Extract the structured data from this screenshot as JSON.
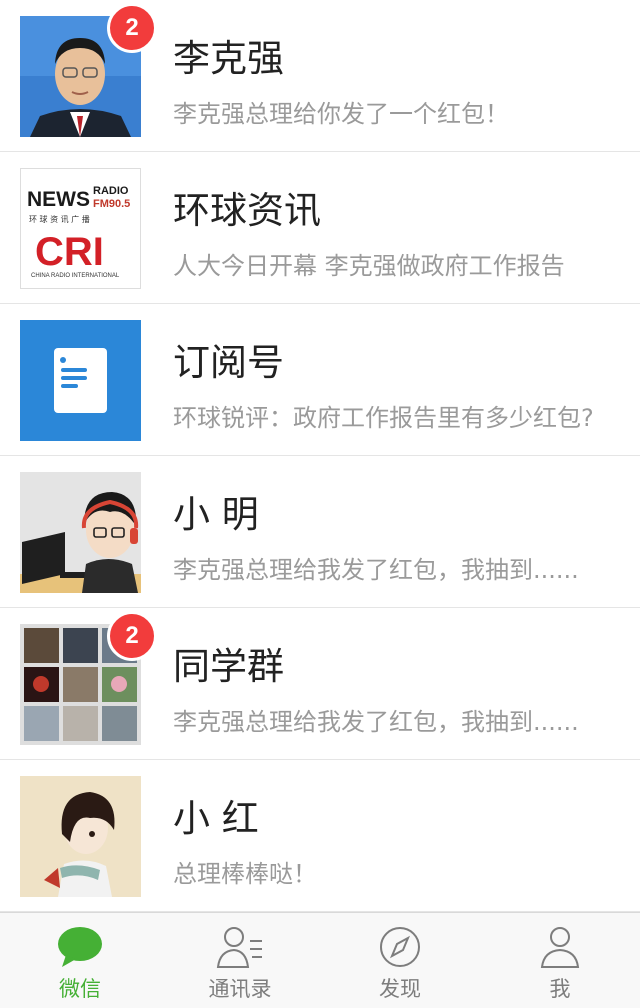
{
  "chats": [
    {
      "name": "李克强",
      "preview": "李克强总理给你发了一个红包！",
      "badge": "2"
    },
    {
      "name": "环球资讯",
      "preview": "人大今日开幕 李克强做政府工作报告",
      "avatar_text": {
        "brand_top": "NEWS",
        "brand_radio": "RADIO",
        "brand_freq": "FM90.5",
        "brand_cn": "环 球 资 讯 广 播",
        "brand_logo": "CRI",
        "brand_en": "CHINA RADIO INTERNATIONAL"
      }
    },
    {
      "name": "订阅号",
      "preview": "环球锐评：政府工作报告里有多少红包?"
    },
    {
      "name": "小 明",
      "preview": "李克强总理给我发了红包，我抽到......"
    },
    {
      "name": "同学群",
      "preview": "李克强总理给我发了红包，我抽到......",
      "badge": "2"
    },
    {
      "name": "小 红",
      "preview": "总理棒棒哒！"
    }
  ],
  "tabs": [
    {
      "label": "微信",
      "icon": "chat-bubble-icon",
      "active": true
    },
    {
      "label": "通讯录",
      "icon": "contacts-icon",
      "active": false
    },
    {
      "label": "发现",
      "icon": "compass-icon",
      "active": false
    },
    {
      "label": "我",
      "icon": "person-icon",
      "active": false
    }
  ],
  "colors": {
    "accent": "#45b035",
    "badge": "#f23c3c",
    "subscription": "#2b87d8"
  }
}
